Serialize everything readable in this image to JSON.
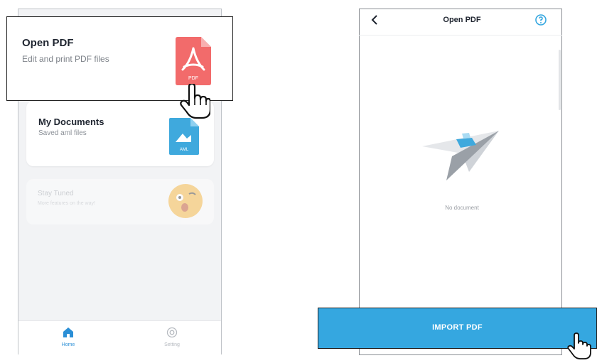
{
  "left_screen": {
    "open_pdf_card": {
      "title": "Open PDF",
      "subtitle": "Edit and print PDF files",
      "icon_badge": "PDF"
    },
    "my_documents_card": {
      "title": "My Documents",
      "subtitle": "Saved aml files",
      "icon_badge": "AML"
    },
    "stay_tuned_card": {
      "title": "Stay Tuned",
      "subtitle": "More features on the way!"
    },
    "tabbar": {
      "home_label": "Home",
      "setting_label": "Setting"
    }
  },
  "right_screen": {
    "header": {
      "title": "Open PDF",
      "back_icon": "chevron-left",
      "help_icon": "question-circle"
    },
    "empty_state": {
      "text": "No document"
    },
    "import_button": {
      "label": "IMPORT PDF"
    }
  },
  "colors": {
    "accent_blue": "#35a7e0",
    "pdf_red": "#f26b6b",
    "xml_blue": "#3fa9dd",
    "home_active": "#2b8fd6"
  }
}
